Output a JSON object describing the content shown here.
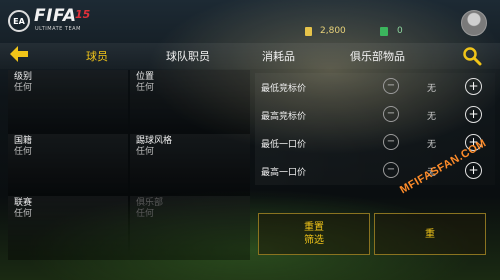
{
  "header": {
    "logo": {
      "brand": "FIFA",
      "edition": "15",
      "subtitle": "ULTIMATE TEAM",
      "badge": "EA SPORTS"
    },
    "coins": {
      "icon": "coin-icon",
      "value": "2,800"
    },
    "points": {
      "icon": "points-icon",
      "value": "0"
    },
    "avatar_icon": "user-avatar-icon"
  },
  "nav": {
    "back_icon": "back-arrow-icon",
    "search_icon": "search-icon",
    "tabs": [
      {
        "label": "球员",
        "active": true
      },
      {
        "label": "球队职员",
        "active": false
      },
      {
        "label": "消耗品",
        "active": false
      },
      {
        "label": "俱乐部物品",
        "active": false
      }
    ]
  },
  "filters": [
    {
      "label": "级别",
      "value": "任何",
      "enabled": true
    },
    {
      "label": "位置",
      "value": "任何",
      "enabled": true
    },
    {
      "label": "国籍",
      "value": "任何",
      "enabled": true
    },
    {
      "label": "踢球风格",
      "value": "任何",
      "enabled": true
    },
    {
      "label": "联赛",
      "value": "任何",
      "enabled": true
    },
    {
      "label": "俱乐部",
      "value": "任何",
      "enabled": false
    }
  ],
  "prices": [
    {
      "label": "最低竞标价",
      "value": "无"
    },
    {
      "label": "最高竞标价",
      "value": "无"
    },
    {
      "label": "最低一口价",
      "value": "无"
    },
    {
      "label": "最高一口价",
      "value": "无"
    }
  ],
  "buttons": {
    "reset": "重置\n筛选",
    "search_partial": "重"
  },
  "watermark": "MFIFASFAN.COM",
  "colors": {
    "accent": "#f0c419",
    "coin": "#e6c34a",
    "points": "#3bb55d",
    "watermark": "#ff8c2a"
  }
}
